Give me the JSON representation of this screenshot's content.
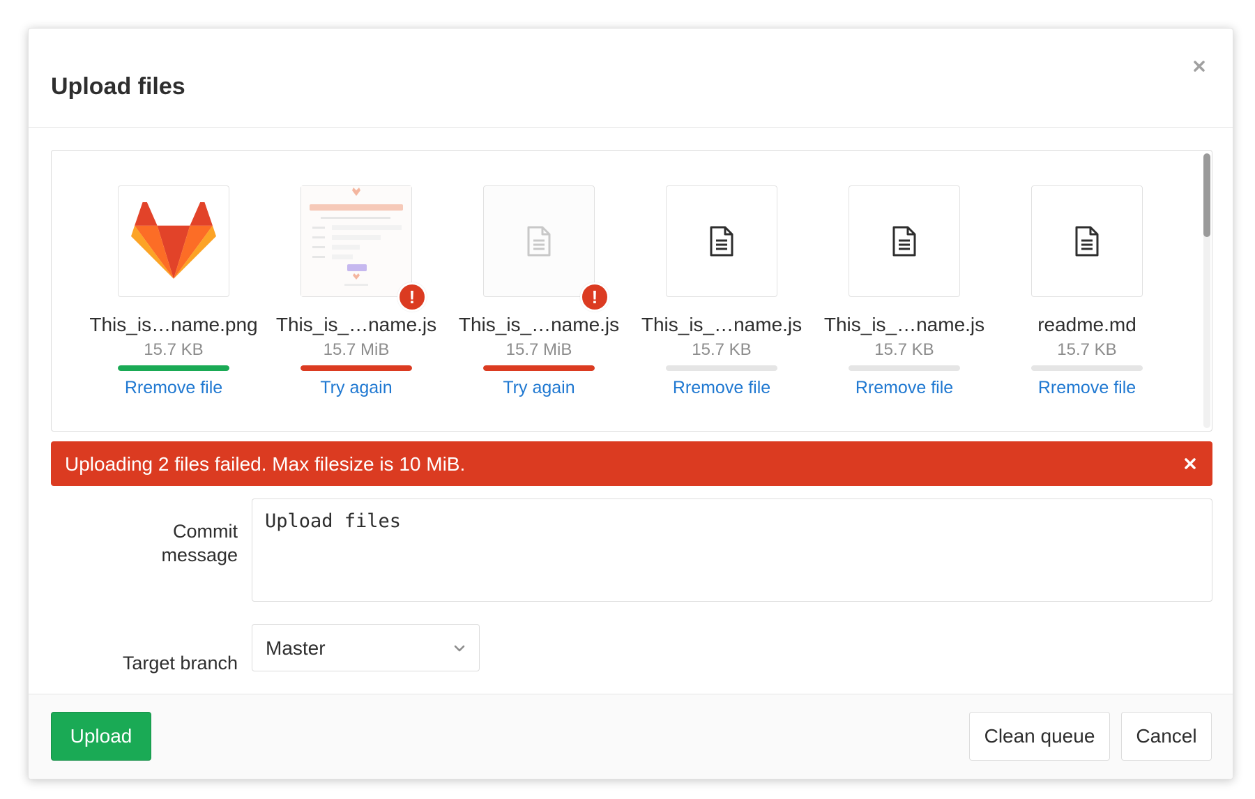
{
  "modal": {
    "title": "Upload files"
  },
  "files": [
    {
      "name": "This_is…name.png",
      "size": "15.7 KB",
      "action": "Rremove file",
      "status": "success",
      "progress": 100,
      "preview": "gitlab-logo-icon"
    },
    {
      "name": "This_is_…name.js",
      "size": "15.7 MiB",
      "action": "Try again",
      "status": "error",
      "progress": 100,
      "preview": "page-screenshot-thumbnail"
    },
    {
      "name": "This_is_…name.js",
      "size": "15.7 MiB",
      "action": "Try again",
      "status": "error",
      "progress": 100,
      "preview": "file-icon"
    },
    {
      "name": "This_is_…name.js",
      "size": "15.7 KB",
      "action": "Rremove file",
      "status": "queued",
      "progress": 0,
      "preview": "file-icon"
    },
    {
      "name": "This_is_…name.js",
      "size": "15.7 KB",
      "action": "Rremove file",
      "status": "queued",
      "progress": 0,
      "preview": "file-icon"
    },
    {
      "name": "readme.md",
      "size": "15.7 KB",
      "action": "Rremove file",
      "status": "queued",
      "progress": 0,
      "preview": "file-icon"
    }
  ],
  "alert": {
    "text": "Uploading 2 files failed. Max filesize is 10 MiB."
  },
  "form": {
    "commit_label": "Commit message",
    "commit_value": "Upload files",
    "branch_label": "Target branch",
    "branch_value": "Master"
  },
  "footer": {
    "upload_label": "Upload",
    "clean_label": "Clean queue",
    "cancel_label": "Cancel"
  },
  "colors": {
    "success": "#1aaa55",
    "error": "#db3b21",
    "link": "#1f78d1",
    "track": "#e5e5e5"
  }
}
